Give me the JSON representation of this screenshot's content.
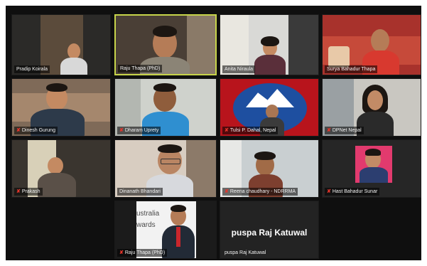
{
  "participants": [
    {
      "name": "Pradip Koirala",
      "muted": false
    },
    {
      "name": "Raju Thapa (PhD)",
      "muted": false
    },
    {
      "name": "Anita Niraula",
      "muted": false
    },
    {
      "name": "Surya Bahadur Thapa",
      "muted": false
    },
    {
      "name": "Dinesh Gurung",
      "muted": true
    },
    {
      "name": "Dharam Uprety",
      "muted": true
    },
    {
      "name": "Tulsi P. Dahal, Nepal",
      "muted": true
    },
    {
      "name": "DPNet Nepal",
      "muted": true
    },
    {
      "name": "Prakash",
      "muted": true
    },
    {
      "name": "Dinanath Bhandari",
      "muted": false
    },
    {
      "name": "Reena chaudhary - NDRRMA",
      "muted": true
    },
    {
      "name": "Hast Bahadur Sunar",
      "muted": true
    },
    {
      "name": "Raju Thapa (PhD)",
      "muted": true
    },
    {
      "name": "puspa Raj Katuwal",
      "muted": false
    }
  ],
  "camera_off_display": "puspa Raj Katuwal",
  "screen_text": "ustralia\nwards",
  "mic_icon": "mic-muted-icon",
  "colors": {
    "active_speaker": "#c7d44a",
    "mic_muted": "#e5352b",
    "background": "#0f0f0f"
  }
}
